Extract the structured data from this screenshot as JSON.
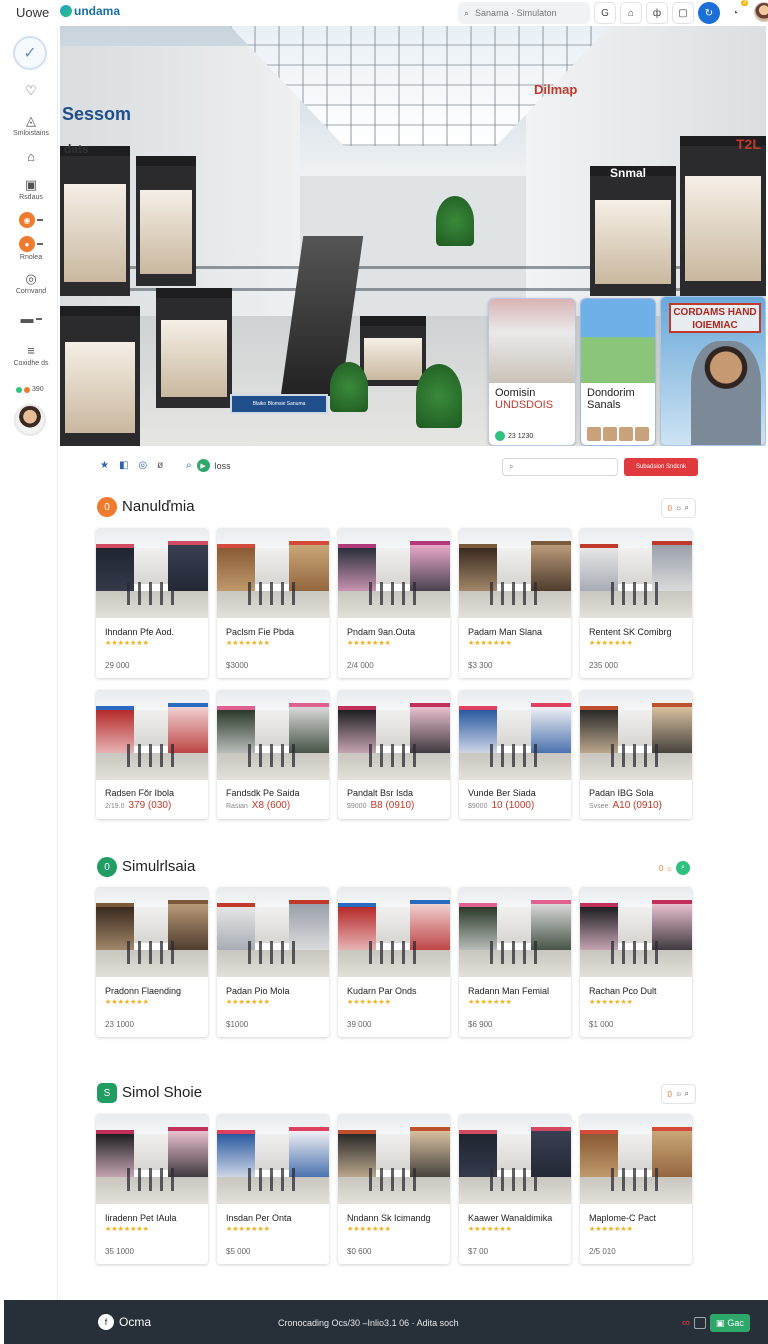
{
  "topbar": {
    "home_label": "Uowe",
    "brand": "undama",
    "search_placeholder": "Sanama · Simulaton",
    "tool_icons": [
      "G",
      "⌂",
      "ф",
      "▢"
    ],
    "notification_count": "3"
  },
  "sidebar": {
    "items": [
      {
        "icon": "♡",
        "label": ""
      },
      {
        "icon": "◬",
        "label": "Smloistains"
      },
      {
        "icon": "⌂",
        "label": ""
      },
      {
        "icon": "▣",
        "label": "Rsdaus"
      },
      {
        "icon": "◉",
        "label": ""
      },
      {
        "icon": "●",
        "label": "Rnolea"
      },
      {
        "icon": "◎",
        "label": "Cornvand"
      },
      {
        "icon": "▬",
        "label": ""
      },
      {
        "icon": "≡",
        "label": "Coxidhe ds"
      }
    ],
    "status_text": "390"
  },
  "hero": {
    "sign_left": "Sessom",
    "sign_left2": "dats",
    "sign_right": "Snmal",
    "sign_right_top": "Dilmap",
    "sign_right_edge": "T2L",
    "info_sign": "Blaiko Blomsie Sanuma",
    "ad1": {
      "line1": "Oomisin",
      "line2": "UNDSDOIS",
      "pill": "23 1230"
    },
    "ad2": {
      "line1": "Dondorim",
      "line2": "Sanals"
    },
    "ad3": {
      "banner": "CORDAMS HAND IOIEMIAC"
    }
  },
  "filter": {
    "chip_label": "loss",
    "search_placeholder": "",
    "button_label": "Subadsion Sndcnk"
  },
  "sections": [
    {
      "title": "Nanulďmia",
      "icon": "0",
      "cards": [
        {
          "name": "Ihndann Pfe Aod.",
          "stars": "★★★★★★★",
          "price": "29 000"
        },
        {
          "name": "Paclsm Fie Pbda",
          "stars": "★★★★★★★",
          "price": "$3000"
        },
        {
          "name": "Pndam 9an.Outa",
          "stars": "★★★★★★★",
          "price": "2/4 000"
        },
        {
          "name": "Padam Man Slana",
          "stars": "★★★★★★★",
          "price": "$3 300"
        },
        {
          "name": "Rentent SK Comibrg",
          "stars": "★★★★★★★",
          "price": "235 000"
        }
      ],
      "cards2": [
        {
          "name": "Radsen Fŏr Ibola",
          "old": "2/19.0",
          "price": "379 (030)"
        },
        {
          "name": "Fandsdk Pe Saida",
          "old": "Rasian",
          "price": "X8 (600)"
        },
        {
          "name": "Pandalt Bsr Isda",
          "old": "$9000",
          "price": "B8 (0910)"
        },
        {
          "name": "Vunde Ber Siada",
          "old": "$9000",
          "price": "10 (1000)"
        },
        {
          "name": "Padan IBG Sola",
          "old": "Svsee",
          "price": "A10 (0910)"
        }
      ]
    },
    {
      "title": "Simulrlsaia",
      "icon": "0",
      "cards": [
        {
          "name": "Pradonn Flaending",
          "stars": "★★★★★★★",
          "price": "23 1000"
        },
        {
          "name": "Padan Pio Mola",
          "stars": "★★★★★★★",
          "price": "$1000"
        },
        {
          "name": "Kudarn Par Onds",
          "stars": "★★★★★★★",
          "price": "39 000"
        },
        {
          "name": "Radann Man Femial",
          "stars": "★★★★★★★",
          "price": "$6 900"
        },
        {
          "name": "Rachan Pco Dult",
          "stars": "★★★★★★★",
          "price": "$1 000"
        }
      ]
    },
    {
      "title": "Simol Shoie",
      "icon": "S",
      "cards": [
        {
          "name": "Iiradenn Pet IAula",
          "stars": "★★★★★★★",
          "price": "35 1000"
        },
        {
          "name": "Insdan Per Onta",
          "stars": "★★★★★★★",
          "price": "$5 000"
        },
        {
          "name": "Nndann Sk Icimandg",
          "stars": "★★★★★★★",
          "price": "$0 600"
        },
        {
          "name": "Kaawer Wanaldimika",
          "stars": "★★★★★★★",
          "price": "$7 00"
        },
        {
          "name": "Maplome-C Pact",
          "stars": "★★★★★★★",
          "price": "2/5 010"
        }
      ]
    }
  ],
  "footer": {
    "brand": "Ocma",
    "text": "Cronocading Ocs/30 –Inlio3.1 06 · Adita soch",
    "button": "Gac"
  },
  "colors": {
    "accent_orange": "#f07a2e",
    "accent_green": "#1f9d63",
    "accent_red": "#e0393e",
    "accent_blue": "#1d6fd8",
    "footer_bg": "#273039"
  }
}
